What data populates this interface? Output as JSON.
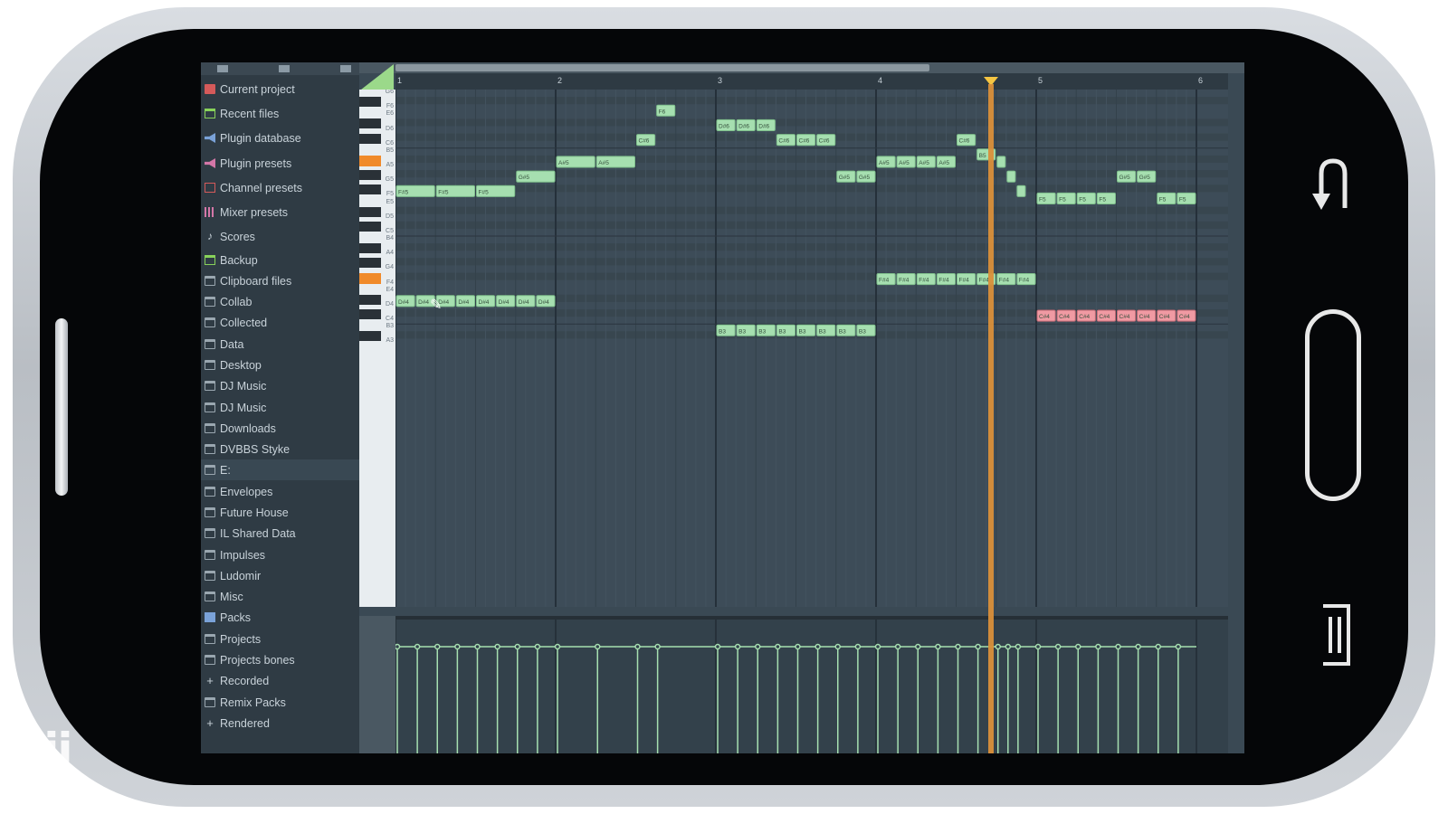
{
  "watermark": "jiji",
  "browser": {
    "items": [
      {
        "label": "Current project",
        "icon": "project-icon"
      },
      {
        "label": "Recent files",
        "icon": "recent-files-icon"
      },
      {
        "label": "Plugin database",
        "icon": "plugin-database-icon"
      },
      {
        "label": "Plugin presets",
        "icon": "plugin-presets-icon"
      },
      {
        "label": "Channel presets",
        "icon": "channel-presets-icon"
      },
      {
        "label": "Mixer presets",
        "icon": "mixer-presets-icon"
      },
      {
        "label": "Scores",
        "icon": "music-note-icon"
      },
      {
        "label": "Backup",
        "icon": "backup-folder-icon"
      },
      {
        "label": "Clipboard files",
        "icon": "folder-icon"
      },
      {
        "label": "Collab",
        "icon": "folder-icon"
      },
      {
        "label": "Collected",
        "icon": "folder-icon"
      },
      {
        "label": "Data",
        "icon": "folder-icon"
      },
      {
        "label": "Desktop",
        "icon": "folder-icon"
      },
      {
        "label": "DJ Music",
        "icon": "folder-icon"
      },
      {
        "label": "DJ Music",
        "icon": "folder-icon"
      },
      {
        "label": "Downloads",
        "icon": "folder-icon"
      },
      {
        "label": "DVBBS Styke",
        "icon": "folder-icon"
      },
      {
        "label": "E:",
        "icon": "folder-icon",
        "selected": true
      },
      {
        "label": "Envelopes",
        "icon": "folder-icon"
      },
      {
        "label": "Future House",
        "icon": "folder-icon"
      },
      {
        "label": "IL Shared Data",
        "icon": "folder-icon"
      },
      {
        "label": "Impulses",
        "icon": "folder-icon"
      },
      {
        "label": "Ludomir",
        "icon": "folder-icon"
      },
      {
        "label": "Misc",
        "icon": "folder-icon"
      },
      {
        "label": "Packs",
        "icon": "packs-icon"
      },
      {
        "label": "Projects",
        "icon": "folder-icon"
      },
      {
        "label": "Projects bones",
        "icon": "folder-icon"
      },
      {
        "label": "Recorded",
        "icon": "plus-icon"
      },
      {
        "label": "Remix Packs",
        "icon": "folder-icon"
      },
      {
        "label": "Rendered",
        "icon": "plus-icon"
      }
    ]
  },
  "ruler": {
    "bars": [
      "1",
      "2",
      "3",
      "4",
      "5",
      "6"
    ]
  },
  "keys": {
    "labels": [
      "G6",
      "F6",
      "E6",
      "D6",
      "C6",
      "B5",
      "A5",
      "G5",
      "F5",
      "E5",
      "D5",
      "C5",
      "B4",
      "A4",
      "G4",
      "F4",
      "E4",
      "D4",
      "C4",
      "B3",
      "A3"
    ]
  },
  "colors": {
    "note": "#a6dfb0",
    "note_selected": "#f09aa3",
    "playhead": "#d98f3a",
    "grid_bg": "#3d4c58"
  },
  "notes": [
    {
      "pitch": "F#5",
      "start": 0.0,
      "len": 0.25
    },
    {
      "pitch": "F#5",
      "start": 0.25,
      "len": 0.25
    },
    {
      "pitch": "F#5",
      "start": 0.5,
      "len": 0.25
    },
    {
      "pitch": "G#5",
      "start": 0.75,
      "len": 0.25
    },
    {
      "pitch": "A#5",
      "start": 1.0,
      "len": 0.25
    },
    {
      "pitch": "A#5",
      "start": 1.25,
      "len": 0.25
    },
    {
      "pitch": "C#6",
      "start": 1.5,
      "len": 0.125
    },
    {
      "pitch": "F6",
      "start": 1.625,
      "len": 0.125
    },
    {
      "pitch": "D#6",
      "start": 2.0,
      "len": 0.125
    },
    {
      "pitch": "D#6",
      "start": 2.125,
      "len": 0.125
    },
    {
      "pitch": "D#6",
      "start": 2.25,
      "len": 0.125
    },
    {
      "pitch": "C#6",
      "start": 2.375,
      "len": 0.125
    },
    {
      "pitch": "C#6",
      "start": 2.5,
      "len": 0.125
    },
    {
      "pitch": "C#6",
      "start": 2.625,
      "len": 0.125
    },
    {
      "pitch": "G#5",
      "start": 2.75,
      "len": 0.125
    },
    {
      "pitch": "G#5",
      "start": 2.875,
      "len": 0.125
    },
    {
      "pitch": "A#5",
      "start": 3.0,
      "len": 0.125
    },
    {
      "pitch": "A#5",
      "start": 3.125,
      "len": 0.125
    },
    {
      "pitch": "A#5",
      "start": 3.25,
      "len": 0.125
    },
    {
      "pitch": "A#5",
      "start": 3.375,
      "len": 0.125
    },
    {
      "pitch": "C#6",
      "start": 3.5,
      "len": 0.125
    },
    {
      "pitch": "B5",
      "start": 3.625,
      "len": 0.125
    },
    {
      "pitch": "A#5",
      "start": 3.75,
      "len": 0.0625
    },
    {
      "pitch": "G#5",
      "start": 3.8125,
      "len": 0.0625
    },
    {
      "pitch": "F#5",
      "start": 3.875,
      "len": 0.0625
    },
    {
      "pitch": "F5",
      "start": 4.0,
      "len": 0.125
    },
    {
      "pitch": "F5",
      "start": 4.125,
      "len": 0.125
    },
    {
      "pitch": "F5",
      "start": 4.25,
      "len": 0.125
    },
    {
      "pitch": "F5",
      "start": 4.375,
      "len": 0.125
    },
    {
      "pitch": "G#5",
      "start": 4.5,
      "len": 0.125
    },
    {
      "pitch": "G#5",
      "start": 4.625,
      "len": 0.125
    },
    {
      "pitch": "F5",
      "start": 4.75,
      "len": 0.125
    },
    {
      "pitch": "F5",
      "start": 4.875,
      "len": 0.125
    },
    {
      "pitch": "D#4",
      "start": 0.0,
      "len": 0.125
    },
    {
      "pitch": "D#4",
      "start": 0.125,
      "len": 0.125
    },
    {
      "pitch": "D#4",
      "start": 0.25,
      "len": 0.125
    },
    {
      "pitch": "D#4",
      "start": 0.375,
      "len": 0.125
    },
    {
      "pitch": "D#4",
      "start": 0.5,
      "len": 0.125
    },
    {
      "pitch": "D#4",
      "start": 0.625,
      "len": 0.125
    },
    {
      "pitch": "D#4",
      "start": 0.75,
      "len": 0.125
    },
    {
      "pitch": "D#4",
      "start": 0.875,
      "len": 0.125
    },
    {
      "pitch": "B3",
      "start": 2.0,
      "len": 0.125
    },
    {
      "pitch": "B3",
      "start": 2.125,
      "len": 0.125
    },
    {
      "pitch": "B3",
      "start": 2.25,
      "len": 0.125
    },
    {
      "pitch": "B3",
      "start": 2.375,
      "len": 0.125
    },
    {
      "pitch": "B3",
      "start": 2.5,
      "len": 0.125
    },
    {
      "pitch": "B3",
      "start": 2.625,
      "len": 0.125
    },
    {
      "pitch": "B3",
      "start": 2.75,
      "len": 0.125
    },
    {
      "pitch": "B3",
      "start": 2.875,
      "len": 0.125
    },
    {
      "pitch": "F#4",
      "start": 3.0,
      "len": 0.125
    },
    {
      "pitch": "F#4",
      "start": 3.125,
      "len": 0.125
    },
    {
      "pitch": "F#4",
      "start": 3.25,
      "len": 0.125
    },
    {
      "pitch": "F#4",
      "start": 3.375,
      "len": 0.125
    },
    {
      "pitch": "F#4",
      "start": 3.5,
      "len": 0.125
    },
    {
      "pitch": "F#4",
      "start": 3.625,
      "len": 0.125
    },
    {
      "pitch": "F#4",
      "start": 3.75,
      "len": 0.125
    },
    {
      "pitch": "F#4",
      "start": 3.875,
      "len": 0.125
    },
    {
      "pitch": "C#4",
      "start": 4.0,
      "len": 0.125,
      "selected": true
    },
    {
      "pitch": "C#4",
      "start": 4.125,
      "len": 0.125,
      "selected": true
    },
    {
      "pitch": "C#4",
      "start": 4.25,
      "len": 0.125,
      "selected": true
    },
    {
      "pitch": "C#4",
      "start": 4.375,
      "len": 0.125,
      "selected": true
    },
    {
      "pitch": "C#4",
      "start": 4.5,
      "len": 0.125,
      "selected": true
    },
    {
      "pitch": "C#4",
      "start": 4.625,
      "len": 0.125,
      "selected": true
    },
    {
      "pitch": "C#4",
      "start": 4.75,
      "len": 0.125,
      "selected": true
    },
    {
      "pitch": "C#4",
      "start": 4.875,
      "len": 0.125,
      "selected": true
    }
  ],
  "playhead_position": 3.72
}
